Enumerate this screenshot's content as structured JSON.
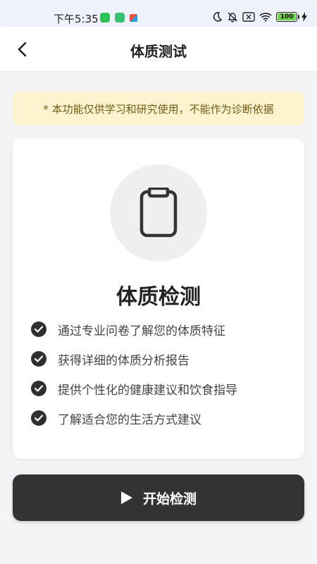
{
  "status_bar": {
    "time": "下午5:35",
    "battery": "100"
  },
  "header": {
    "title": "体质测试"
  },
  "notice": {
    "text": "* 本功能仅供学习和研究使用，不能作为诊断依据"
  },
  "card": {
    "icon": "clipboard-icon",
    "title": "体质检测",
    "features": [
      "通过专业问卷了解您的体质特征",
      "获得详细的体质分析报告",
      "提供个性化的健康建议和饮食指导",
      "了解适合您的生活方式建议"
    ]
  },
  "actions": {
    "start_label": "开始检测"
  },
  "colors": {
    "notice_bg": "#fdf4cf",
    "notice_text": "#6f5a17",
    "button_bg": "#333333",
    "page_bg": "#f4f3f5"
  }
}
